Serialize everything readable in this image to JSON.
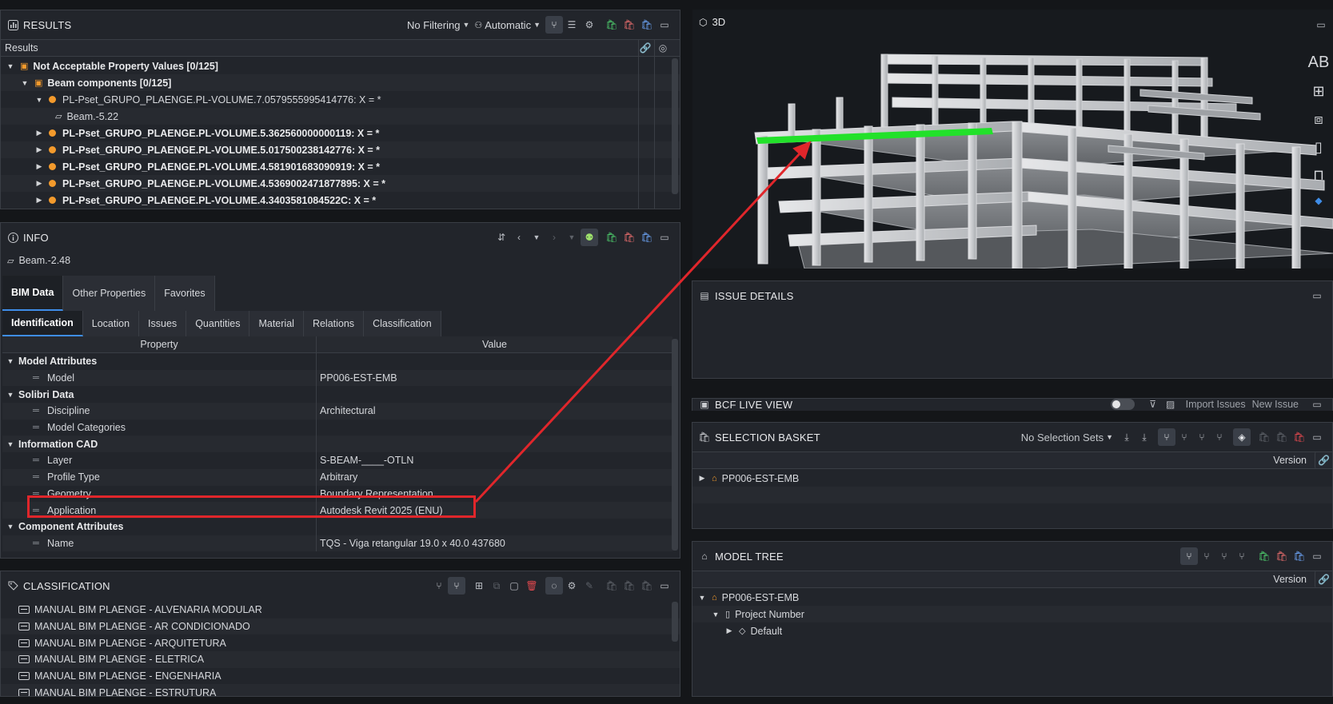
{
  "results": {
    "title": "RESULTS",
    "filter": "No Filtering",
    "mode": "Automatic",
    "sub_header": "Results",
    "rows": [
      {
        "label": "Not Acceptable Property Values [0/125]",
        "level": 0,
        "bold": true
      },
      {
        "label": "Beam components [0/125]",
        "level": 1,
        "bold": true
      },
      {
        "label": "PL-Pset_GRUPO_PLAENGE.PL-VOLUME.7.0579555995414776: X = *",
        "level": 2,
        "bold": false
      },
      {
        "label": "Beam.-5.22",
        "level": 3,
        "bold": false
      },
      {
        "label": "PL-Pset_GRUPO_PLAENGE.PL-VOLUME.5.362560000000119: X = *",
        "level": 2,
        "bold": true
      },
      {
        "label": "PL-Pset_GRUPO_PLAENGE.PL-VOLUME.5.017500238142776: X = *",
        "level": 2,
        "bold": true
      },
      {
        "label": "PL-Pset_GRUPO_PLAENGE.PL-VOLUME.4.581901683090919: X = *",
        "level": 2,
        "bold": true
      },
      {
        "label": "PL-Pset_GRUPO_PLAENGE.PL-VOLUME.4.5369002471877895: X = *",
        "level": 2,
        "bold": true
      },
      {
        "label": "PL-Pset_GRUPO_PLAENGE.PL-VOLUME.4.3403581084522C: X = *",
        "level": 2,
        "bold": true
      }
    ]
  },
  "info": {
    "title": "INFO",
    "selected": "Beam.-2.48",
    "tabs": [
      "BIM Data",
      "Other Properties",
      "Favorites"
    ],
    "subtabs": [
      "Identification",
      "Location",
      "Issues",
      "Quantities",
      "Material",
      "Relations",
      "Classification"
    ],
    "col_property": "Property",
    "col_value": "Value",
    "rows": [
      {
        "group": true,
        "property": "Model Attributes",
        "value": ""
      },
      {
        "group": false,
        "property": "Model",
        "value": "PP006-EST-EMB"
      },
      {
        "group": true,
        "property": "Solibri Data",
        "value": ""
      },
      {
        "group": false,
        "property": "Discipline",
        "value": "Architectural"
      },
      {
        "group": false,
        "property": "Model Categories",
        "value": ""
      },
      {
        "group": true,
        "property": "Information CAD",
        "value": ""
      },
      {
        "group": false,
        "property": "Layer",
        "value": "S-BEAM-____-OTLN"
      },
      {
        "group": false,
        "property": "Profile Type",
        "value": "Arbitrary"
      },
      {
        "group": false,
        "property": "Geometry",
        "value": "Boundary Representation"
      },
      {
        "group": false,
        "property": "Application",
        "value": "Autodesk Revit 2025 (ENU)"
      },
      {
        "group": true,
        "property": "Component Attributes",
        "value": ""
      },
      {
        "group": false,
        "property": "Name",
        "value": "TQS - Viga retangular 19.0 x 40.0 437680"
      }
    ]
  },
  "classification": {
    "title": "CLASSIFICATION",
    "items": [
      "MANUAL BIM PLAENGE - ALVENARIA MODULAR",
      "MANUAL BIM PLAENGE - AR CONDICIONADO",
      "MANUAL BIM PLAENGE - ARQUITETURA",
      "MANUAL BIM PLAENGE - ELETRICA",
      "MANUAL BIM PLAENGE - ENGENHARIA",
      "MANUAL BIM PLAENGE - ESTRUTURA"
    ]
  },
  "view3d": {
    "title": "3D",
    "side_label": "AB"
  },
  "issue_details": {
    "title": "ISSUE DETAILS"
  },
  "bcf": {
    "title": "BCF LIVE VIEW",
    "import_label": "Import Issues",
    "new_label": "New Issue"
  },
  "selection_basket": {
    "title": "SELECTION BASKET",
    "sets": "No Selection Sets",
    "column": "Version",
    "rows": [
      "PP006-EST-EMB"
    ]
  },
  "model_tree": {
    "title": "MODEL TREE",
    "column": "Version",
    "rows": [
      {
        "label": "PP006-EST-EMB",
        "level": 0
      },
      {
        "label": "Project Number",
        "level": 1
      },
      {
        "label": "Default",
        "level": 2
      }
    ]
  },
  "colors": {
    "highlight_red": "#e0262b",
    "beam_green": "#22e12a",
    "accent_blue": "#3f8de8",
    "dot_orange": "#f39a2c"
  }
}
